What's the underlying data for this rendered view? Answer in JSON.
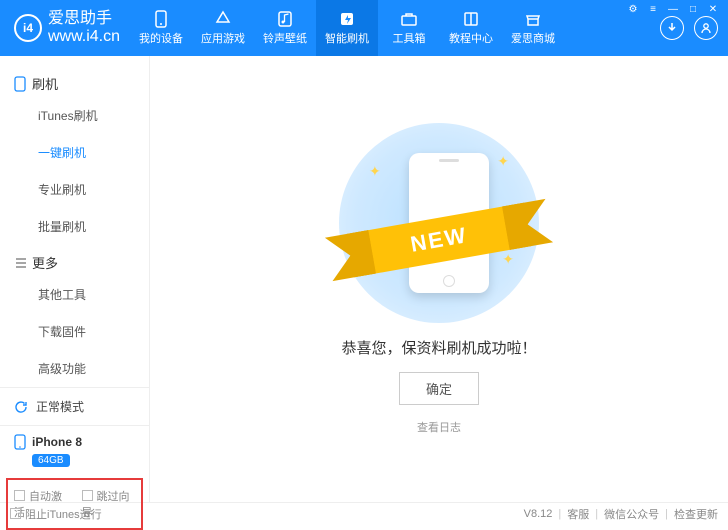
{
  "brand": {
    "logo": "i4",
    "name": "爱思助手",
    "url": "www.i4.cn"
  },
  "nav": [
    {
      "label": "我的设备",
      "icon": "device"
    },
    {
      "label": "应用游戏",
      "icon": "apps"
    },
    {
      "label": "铃声壁纸",
      "icon": "music"
    },
    {
      "label": "智能刷机",
      "icon": "flash",
      "active": true
    },
    {
      "label": "工具箱",
      "icon": "toolbox"
    },
    {
      "label": "教程中心",
      "icon": "book"
    },
    {
      "label": "爱思商城",
      "icon": "store"
    }
  ],
  "sidebar": {
    "groups": [
      {
        "title": "刷机",
        "icon": "flash-icon",
        "items": [
          "iTunes刷机",
          "一键刷机",
          "专业刷机",
          "批量刷机"
        ],
        "activeIndex": 1
      },
      {
        "title": "更多",
        "icon": "more-icon",
        "items": [
          "其他工具",
          "下载固件",
          "高级功能"
        ],
        "activeIndex": -1
      }
    ],
    "mode": "正常模式",
    "device": {
      "name": "iPhone 8",
      "storage": "64GB"
    },
    "checks": [
      "自动激活",
      "跳过向导"
    ]
  },
  "main": {
    "ribbon": "NEW",
    "message": "恭喜您，保资料刷机成功啦！",
    "ok": "确定",
    "log": "查看日志"
  },
  "status": {
    "left": "阻止iTunes运行",
    "version": "V8.12",
    "links": [
      "客服",
      "微信公众号",
      "检查更新"
    ]
  }
}
